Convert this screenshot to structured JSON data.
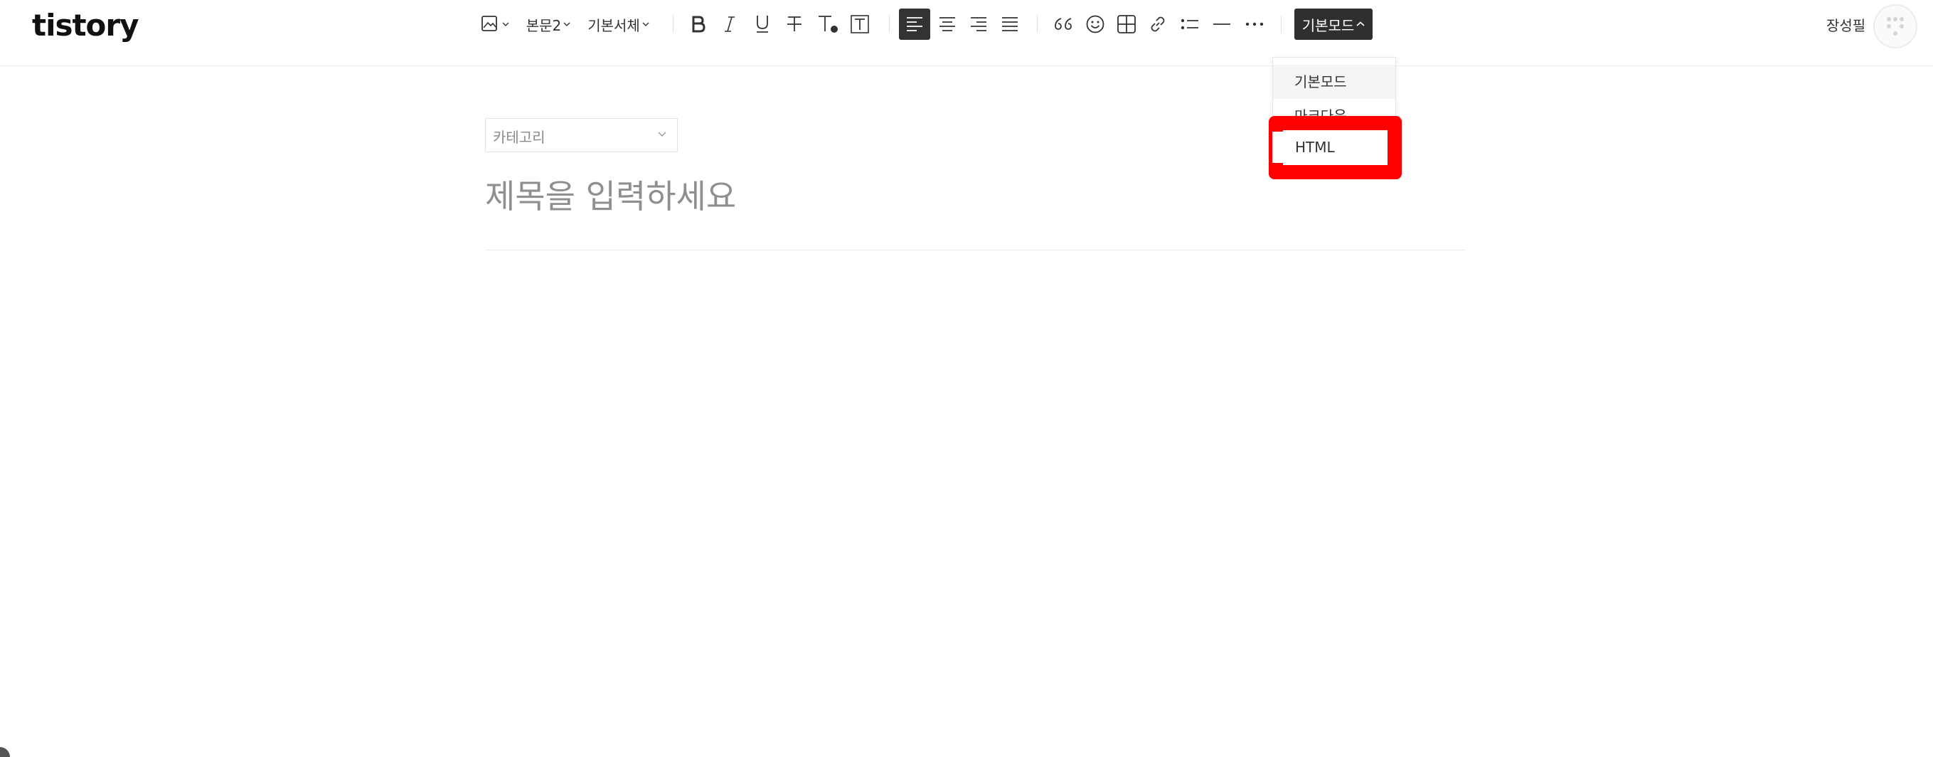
{
  "header": {
    "logo": "tistory",
    "toolbar": {
      "paragraph_style": "본문2",
      "font": "기본서체",
      "mode_label": "기본모드"
    },
    "user_name": "장성필"
  },
  "mode_menu": {
    "items": [
      "기본모드",
      "마크다운",
      "HTML"
    ],
    "selected": "기본모드"
  },
  "editor": {
    "category_placeholder": "카테고리",
    "title_placeholder": "제목을 입력하세요"
  },
  "colors": {
    "highlight": "#ff0000",
    "active": "#333333"
  }
}
